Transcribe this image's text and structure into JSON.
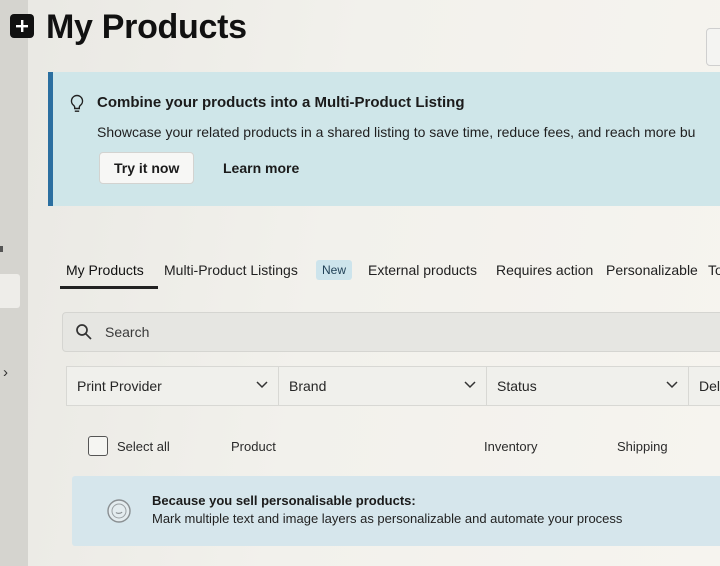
{
  "page": {
    "title": "My Products"
  },
  "banner": {
    "title": "Combine your products into a Multi-Product Listing",
    "description": "Showcase your related products in a shared listing to save time, reduce fees, and reach more bu",
    "try_label": "Try it now",
    "learn_label": "Learn more"
  },
  "tabs": [
    {
      "label": "My Products",
      "active": true
    },
    {
      "label": "Multi-Product Listings",
      "badge": "New"
    },
    {
      "label": "External products"
    },
    {
      "label": "Requires action"
    },
    {
      "label": "Personalizable"
    },
    {
      "label": "To"
    }
  ],
  "search": {
    "placeholder": "Search"
  },
  "filters": [
    {
      "label": "Print Provider"
    },
    {
      "label": "Brand"
    },
    {
      "label": "Status"
    },
    {
      "label": "Del"
    }
  ],
  "table": {
    "select_all": "Select all",
    "columns": [
      "Product",
      "Inventory",
      "Shipping"
    ]
  },
  "info": {
    "title": "Because you sell personalisable products:",
    "description": "Mark multiple text and image layers as personalizable and automate your process"
  },
  "colors": {
    "accent": "#2b6fa0",
    "banner_bg": "#cfe6e9",
    "info_bg": "#d6e6ec"
  }
}
